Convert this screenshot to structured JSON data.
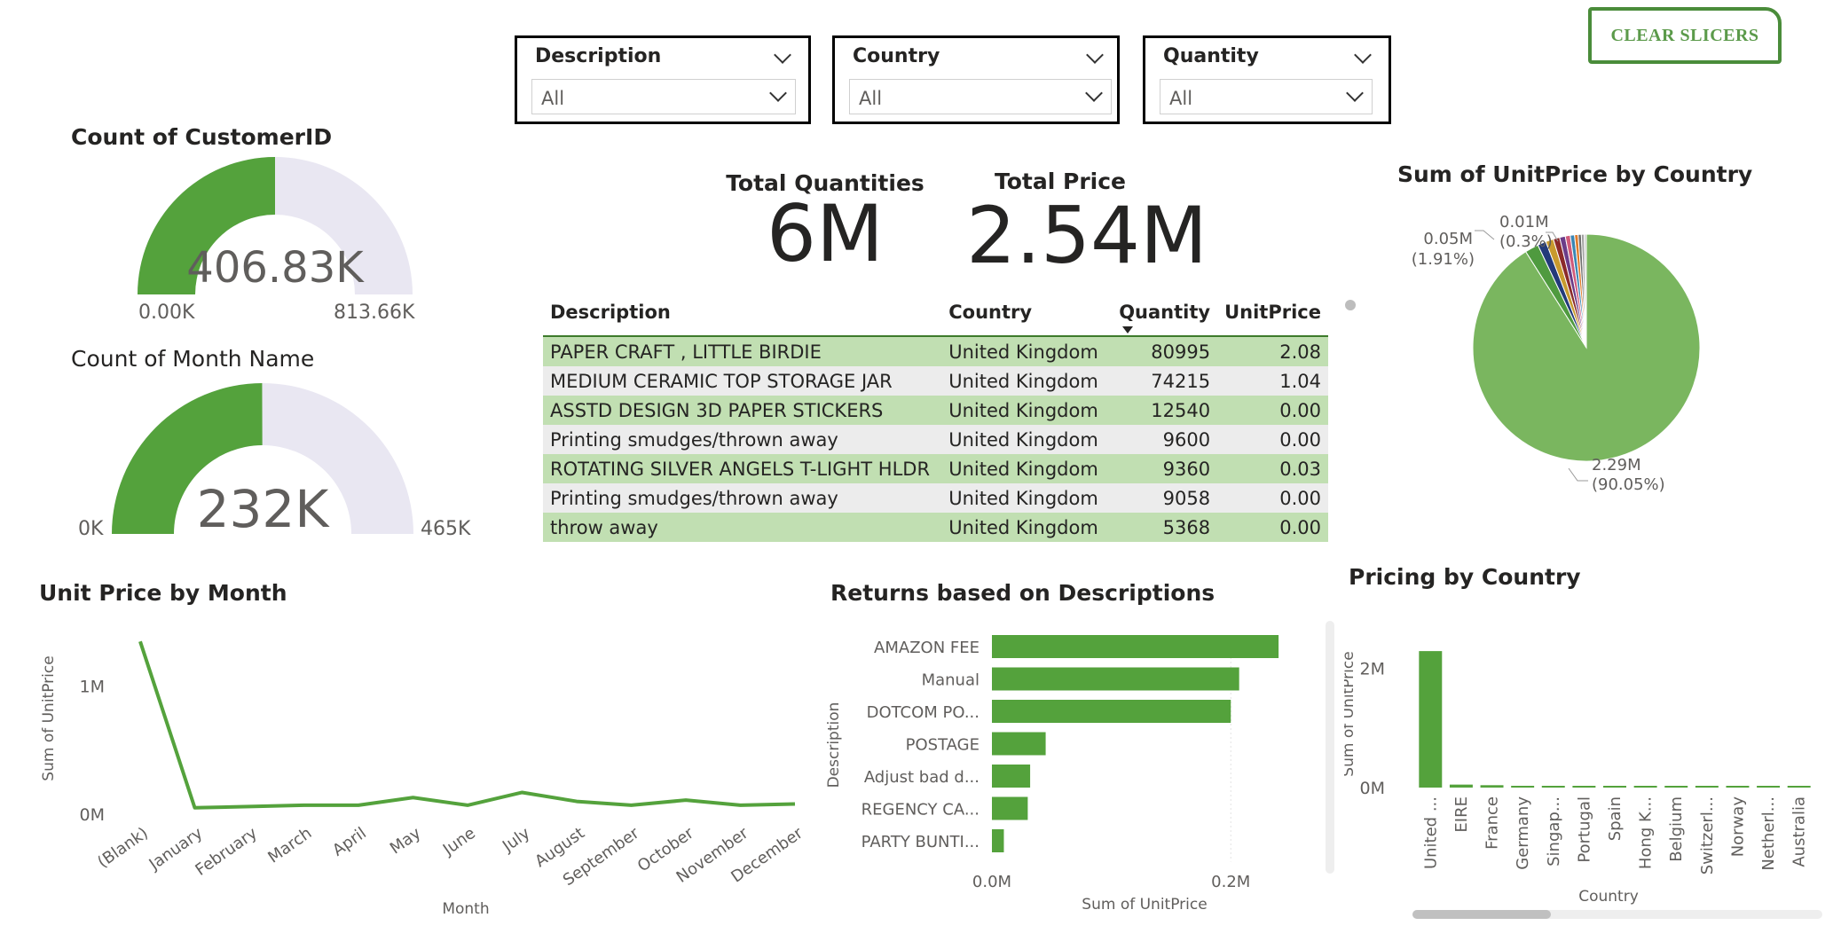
{
  "slicers": [
    {
      "title": "Description",
      "value": "All"
    },
    {
      "title": "Country",
      "value": "All"
    },
    {
      "title": "Quantity",
      "value": "All"
    }
  ],
  "clear_slicers_label": "CLEAR SLICERS",
  "colors": {
    "accent": "#54a23c",
    "light_accent": "#c1dfb2",
    "gauge_track": "#e9e7f2"
  },
  "gauges": [
    {
      "title": "Count of CustomerID",
      "value_label": "406.83K",
      "min_label": "0.00K",
      "max_label": "813.66K",
      "value": 406830,
      "max": 813660
    },
    {
      "title": "Count of Month Name",
      "value_label": "232K",
      "min_label": "0K",
      "max_label": "465K",
      "value": 232000,
      "max": 465000
    }
  ],
  "kpis": [
    {
      "label": "Total Quantities",
      "value": "6M"
    },
    {
      "label": "Total Price",
      "value": "2.54M"
    }
  ],
  "table": {
    "columns": [
      "Description",
      "Country",
      "Quantity",
      "UnitPrice"
    ],
    "sort_icon": "sort-desc-icon",
    "rows": [
      [
        "PAPER CRAFT , LITTLE BIRDIE",
        "United Kingdom",
        "80995",
        "2.08"
      ],
      [
        "MEDIUM CERAMIC TOP STORAGE JAR",
        "United Kingdom",
        "74215",
        "1.04"
      ],
      [
        "ASSTD DESIGN 3D PAPER STICKERS",
        "United Kingdom",
        "12540",
        "0.00"
      ],
      [
        "Printing smudges/thrown away",
        "United Kingdom",
        "9600",
        "0.00"
      ],
      [
        "ROTATING SILVER ANGELS T-LIGHT HLDR",
        "United Kingdom",
        "9360",
        "0.03"
      ],
      [
        "Printing smudges/thrown away",
        "United Kingdom",
        "9058",
        "0.00"
      ],
      [
        "throw away",
        "United Kingdom",
        "5368",
        "0.00"
      ]
    ]
  },
  "chart_data": [
    {
      "type": "pie",
      "title": "Sum of UnitPrice by Country",
      "slices": [
        {
          "value": 2.29,
          "share": 90.05,
          "color": "#7ab65f"
        },
        {
          "value": 0.05,
          "share": 1.91,
          "color": "#4f9a3f"
        },
        {
          "value": 0.03,
          "share": 1.2,
          "color": "#233a7a"
        },
        {
          "value": 0.03,
          "share": 1.1,
          "color": "#c89a2e"
        },
        {
          "value": 0.02,
          "share": 0.9,
          "color": "#8b2a2a"
        },
        {
          "value": 0.02,
          "share": 0.8,
          "color": "#6b3c88"
        },
        {
          "value": 0.02,
          "share": 0.7,
          "color": "#d05a7a"
        },
        {
          "value": 0.01,
          "share": 0.6,
          "color": "#3a86b4"
        },
        {
          "value": 0.01,
          "share": 0.5,
          "color": "#e07a2a"
        },
        {
          "value": 0.01,
          "share": 0.45,
          "color": "#707070"
        },
        {
          "value": 0.01,
          "share": 0.4,
          "color": "#a0a0a0"
        },
        {
          "value": 0.01,
          "share": 0.3,
          "color": "#c8c8c8"
        }
      ],
      "labels": [
        {
          "value_label": "2.29M",
          "pct_label": "(90.05%)"
        },
        {
          "value_label": "0.05M",
          "pct_label": "(1.91%)"
        },
        {
          "value_label": "0.01M",
          "pct_label": "(0.3%)"
        }
      ]
    },
    {
      "type": "line",
      "title": "Unit Price by Month",
      "xlabel": "Month",
      "ylabel": "Sum of UnitPrice",
      "categories": [
        "(Blank)",
        "January",
        "February",
        "March",
        "April",
        "May",
        "June",
        "July",
        "August",
        "September",
        "October",
        "November",
        "December"
      ],
      "values": [
        1.35,
        0.05,
        0.06,
        0.07,
        0.07,
        0.13,
        0.07,
        0.17,
        0.1,
        0.07,
        0.11,
        0.07,
        0.08
      ],
      "yticks": [
        {
          "v": 0,
          "label": "0M"
        },
        {
          "v": 1,
          "label": "1M"
        }
      ],
      "ylim": [
        0,
        1.4
      ],
      "color": "#54a23c"
    },
    {
      "type": "bar",
      "orientation": "horizontal",
      "title": "Returns based on Descriptions",
      "xlabel": "Sum of UnitPrice",
      "ylabel": "Description",
      "categories": [
        "AMAZON FEE",
        "Manual",
        "DOTCOM PO...",
        "POSTAGE",
        "Adjust bad d...",
        "REGENCY CA...",
        "PARTY BUNTI..."
      ],
      "values": [
        0.24,
        0.207,
        0.2,
        0.045,
        0.032,
        0.03,
        0.01
      ],
      "xticks": [
        {
          "v": 0,
          "label": "0.0M"
        },
        {
          "v": 0.2,
          "label": "0.2M"
        }
      ],
      "xlim": [
        0,
        0.26
      ],
      "color": "#54a23c"
    },
    {
      "type": "bar",
      "title": "Pricing by Country",
      "xlabel": "Country",
      "ylabel": "Sum of UnitPrice",
      "categories": [
        "United ...",
        "EIRE",
        "France",
        "Germany",
        "Singap...",
        "Portugal",
        "Spain",
        "Hong K...",
        "Belgium",
        "Switzerl...",
        "Norway",
        "Netherl...",
        "Australia"
      ],
      "values": [
        2.29,
        0.05,
        0.04,
        0.03,
        0.02,
        0.015,
        0.013,
        0.012,
        0.011,
        0.01,
        0.009,
        0.008,
        0.007
      ],
      "yticks": [
        {
          "v": 0,
          "label": "0M"
        },
        {
          "v": 2,
          "label": "2M"
        }
      ],
      "ylim": [
        0,
        2.5
      ],
      "color": "#54a23c"
    }
  ]
}
